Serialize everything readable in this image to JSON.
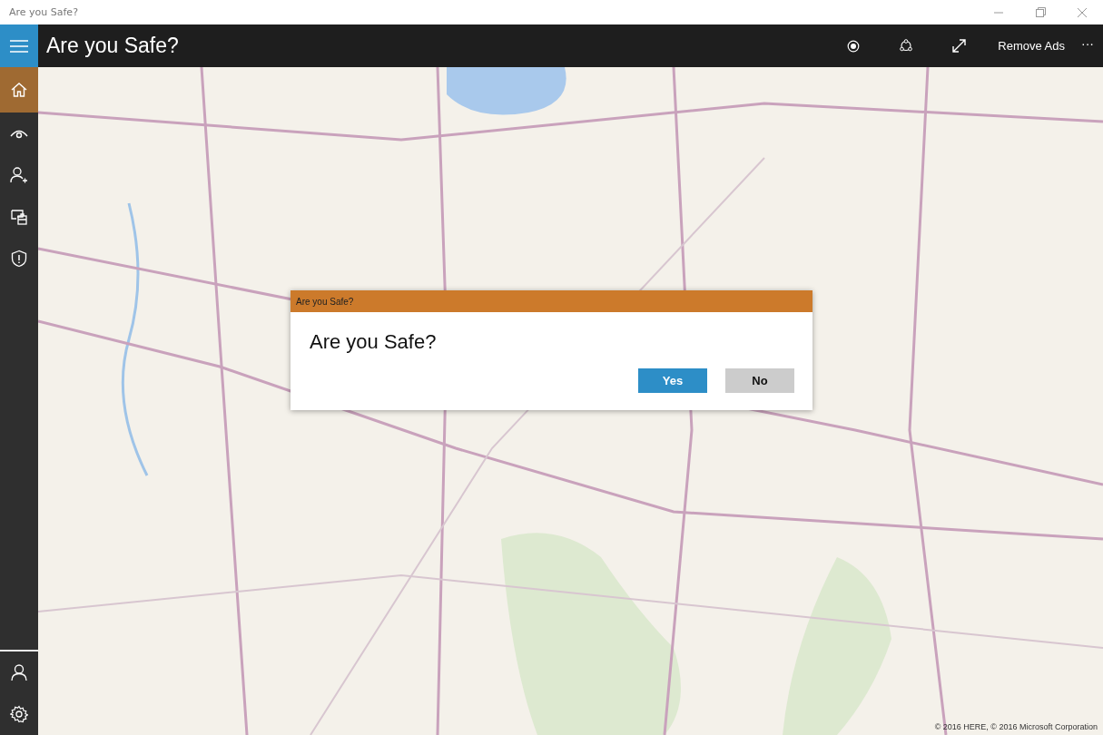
{
  "window": {
    "title": "Are you Safe?"
  },
  "app_bar": {
    "title": "Are you Safe?",
    "action_label": "Remove Ads",
    "more": "···"
  },
  "nav_items": [
    {
      "selected": true
    },
    {
      "selected": false
    },
    {
      "selected": false
    },
    {
      "selected": false
    },
    {
      "selected": false
    }
  ],
  "nav_footer_items": [
    {
      "selected": false
    },
    {
      "selected": false
    }
  ],
  "map": {
    "kind": "picture",
    "attribution": "© 2016 HERE, © 2016 Microsoft Corporation"
  },
  "dialog": {
    "title": "Are you Safe?",
    "message": "Are you Safe?",
    "buttons": [
      {
        "label": "Yes",
        "kind": "primary"
      },
      {
        "label": "No",
        "kind": "secondary"
      }
    ]
  }
}
